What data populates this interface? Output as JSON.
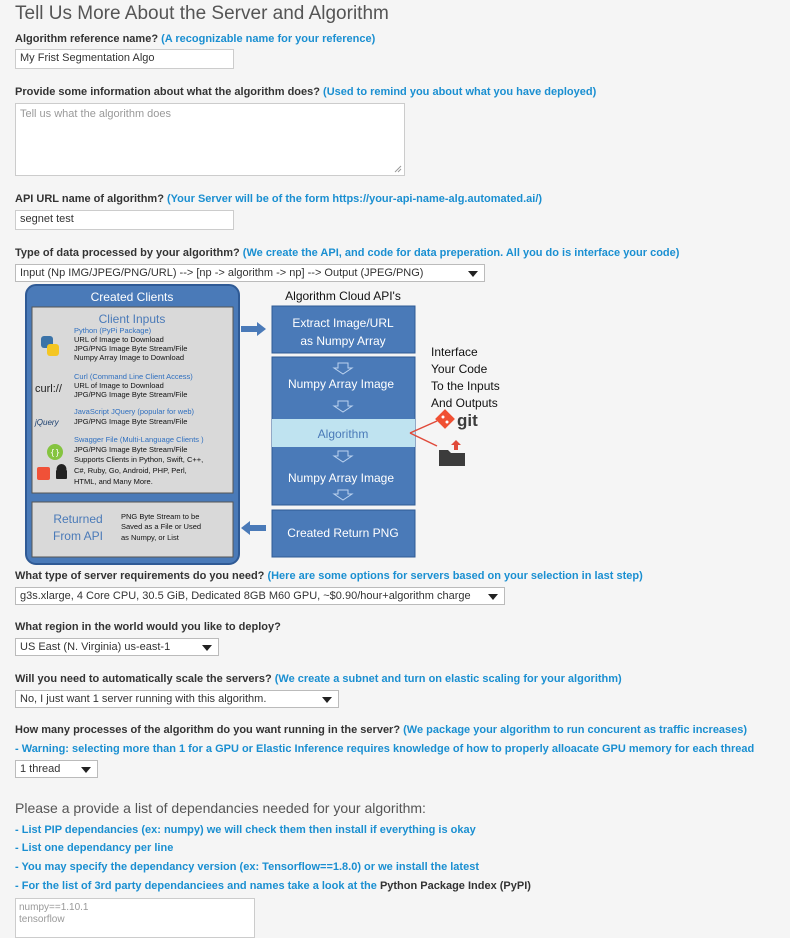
{
  "page_title": "Tell Us More About the Server and Algorithm",
  "ref_name": {
    "label": "Algorithm reference name?",
    "hint": "(A recognizable name for your reference)",
    "value": "My Frist Segmentation Algo"
  },
  "info": {
    "label": "Provide some information about what the algorithm does?",
    "hint": "(Used to remind you about what you have deployed)",
    "placeholder": "Tell us what the algorithm does"
  },
  "api_url": {
    "label": "API URL name of algorithm?",
    "hint": "(Your Server will be of the form https://your-api-name-alg.automated.ai/)",
    "value": "segnet test"
  },
  "data_type": {
    "label": "Type of data processed by your algorithm?",
    "hint": "(We create the API, and code for data preperation. All you do is interface your code)",
    "selected": "Input (Np IMG/JPEG/PNG/URL) --> [np -> algorithm -> np] --> Output (JPEG/PNG)"
  },
  "diagram": {
    "created_clients": "Created Clients",
    "client_inputs": "Client Inputs",
    "python_title": "Python (PyPi Package)",
    "python_lines": [
      "URL of Image to Download",
      "JPG/PNG Image Byte Stream/File",
      "Numpy Array Image to Download"
    ],
    "curl_logo": "curl://",
    "curl_title": "Curl (Command Line Client Access)",
    "curl_lines": [
      "URL of Image to Download",
      "JPG/PNG Image Byte Stream/File"
    ],
    "jquery_logo": "jQuery",
    "jquery_title": "JavaScript JQuery (popular for web)",
    "jquery_lines": [
      "JPG/PNG Image Byte Stream/File"
    ],
    "swagger_title": "Swagger File (Multi-Language Clients )",
    "swagger_lines": [
      "JPG/PNG Image Byte Stream/File",
      "Supports Clients in Python, Swift, C++,",
      "C#, Ruby, Go, Android, PHP, Perl,",
      "HTML, and Many More."
    ],
    "returned": [
      "Returned",
      "From API"
    ],
    "returned_desc": [
      "PNG Byte Stream to be",
      "Saved as a File or Used",
      "as Numpy, or List"
    ],
    "cloud_title": "Algorithm Cloud API's",
    "extract": [
      "Extract Image/URL",
      "as Numpy Array"
    ],
    "numpy_in": "Numpy Array Image",
    "algorithm": "Algorithm",
    "numpy_out": "Numpy Array Image",
    "return_png": "Created Return PNG",
    "interface": [
      "Interface",
      "Your Code",
      "To the Inputs",
      "And Outputs"
    ],
    "git": "git",
    "colors": {
      "blue": "#4a7ab8",
      "dark_blue": "#2f5a95",
      "light": "#bfe3f0",
      "gray": "#d9d9d9"
    }
  },
  "server": {
    "label": "What type of server requirements do you need?",
    "hint": "(Here are some options for servers based on your selection in last step)",
    "selected": "g3s.xlarge, 4 Core CPU, 30.5 GiB, Dedicated 8GB M60 GPU, ~$0.90/hour+algorithm charge"
  },
  "region": {
    "label": "What region in the world would you like to deploy?",
    "selected": "US East (N. Virginia) us-east-1"
  },
  "scale": {
    "label": "Will you need to automatically scale the servers?",
    "hint": "(We create a subnet and turn on elastic scaling for your algorithm)",
    "selected": "No, I just want 1 server running with this algorithm."
  },
  "processes": {
    "label": "How many processes of the algorithm do you want running in the server?",
    "hint": "(We package your algorithm to run concurent as traffic increases)",
    "warning": "- Warning: selecting more than 1 for a GPU or Elastic Inference requires knowledge of how to properly alloacate GPU memory for each thread",
    "selected": "1 thread"
  },
  "deps": {
    "title": "Please a provide a list of dependancies needed for your algorithm:",
    "items": [
      "- List PIP dependancies (ex: numpy) we will check them then install if everything is okay",
      "- List one dependancy per line",
      "- You may specify the dependancy version (ex: Tensorflow==1.8.0) or we install the latest",
      "- For the list of 3rd party dependanciees and names take a look at the"
    ],
    "pypi": "Python Package Index (PyPI)",
    "placeholder_lines": [
      "numpy==1.10.1",
      "tensorflow"
    ]
  }
}
